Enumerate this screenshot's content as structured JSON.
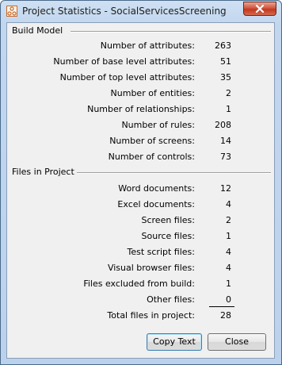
{
  "window": {
    "title": "Project Statistics - SocialServicesScreening"
  },
  "build_model": {
    "header": "Build Model",
    "rows": [
      {
        "label": "Number of attributes:",
        "value": "263"
      },
      {
        "label": "Number of base level attributes:",
        "value": "51"
      },
      {
        "label": "Number of top level attributes:",
        "value": "35"
      },
      {
        "label": "Number of entities:",
        "value": "2"
      },
      {
        "label": "Number of relationships:",
        "value": "1"
      },
      {
        "label": "Number of rules:",
        "value": "208"
      },
      {
        "label": "Number of screens:",
        "value": "14"
      },
      {
        "label": "Number of controls:",
        "value": "73"
      }
    ]
  },
  "files_in_project": {
    "header": "Files in Project",
    "rows": [
      {
        "label": "Word documents:",
        "value": "12"
      },
      {
        "label": "Excel documents:",
        "value": "4"
      },
      {
        "label": "Screen files:",
        "value": "2"
      },
      {
        "label": "Source files:",
        "value": "1"
      },
      {
        "label": "Test script files:",
        "value": "4"
      },
      {
        "label": "Visual browser files:",
        "value": "4"
      },
      {
        "label": "Files excluded from build:",
        "value": "1"
      },
      {
        "label": "Other files:",
        "value": "0"
      }
    ],
    "total": {
      "label": "Total files in project:",
      "value": "28"
    }
  },
  "buttons": {
    "copy_text": "Copy Text",
    "close": "Close"
  }
}
